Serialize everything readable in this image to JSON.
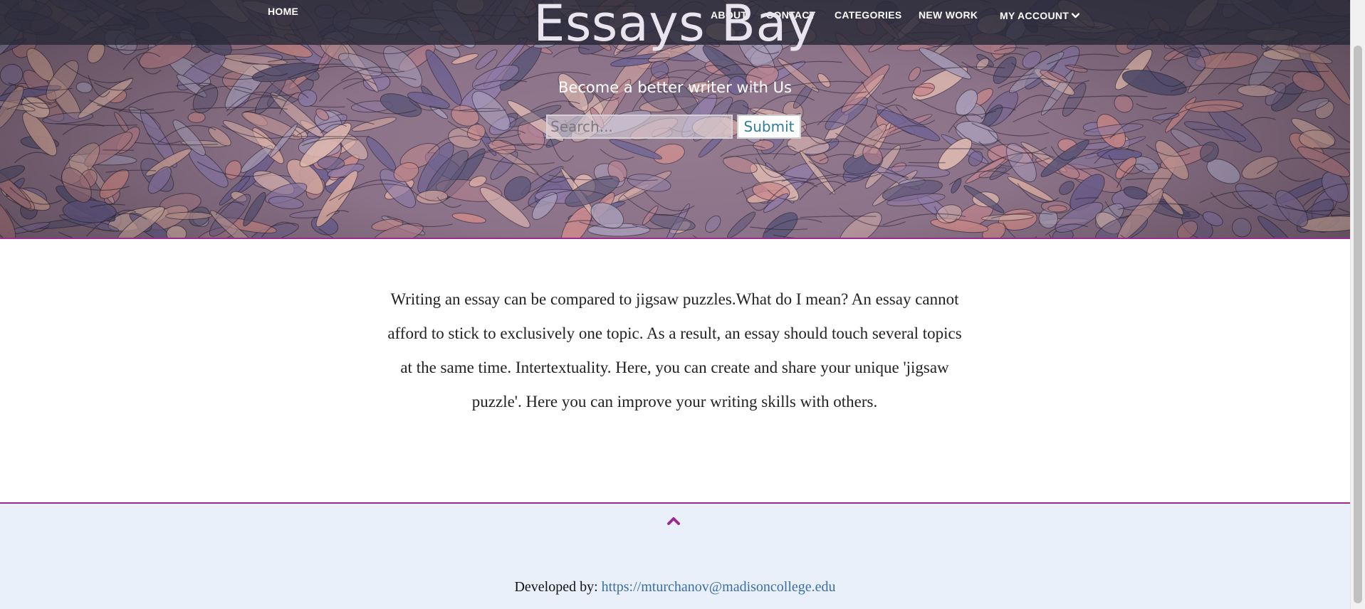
{
  "nav": {
    "home": "HOME",
    "about": "ABOUT",
    "contact": "CONTACT",
    "categories": "CATEGORIES",
    "new_work": "NEW WORK",
    "my_account": "MY ACCOUNT"
  },
  "hero": {
    "title": "Essays Bay",
    "tagline": "Become a better writer with Us"
  },
  "search": {
    "placeholder": "Search...",
    "value": "",
    "submit_label": "Submit"
  },
  "intro": {
    "text": "Writing an essay can be compared to jigsaw puzzles.What do I mean? An essay cannot afford to stick to exclusively one topic. As a result, an essay should touch several topics at the same time. Intertextuality. Here, you can create and share your unique 'jigsaw puzzle'. Here you can improve your writing skills with others."
  },
  "footer": {
    "developed_by_label": "Developed by:",
    "developer_link": "https://mturchanov@madisoncollege.edu",
    "to_top_icon": "chevron-up-icon"
  },
  "colors": {
    "accent": "#9b2a8f",
    "navbar_bg": "#282a38",
    "footer_bg": "#e9f0fa",
    "link": "#3a6ea5",
    "submit_text": "#2f7d9a"
  }
}
